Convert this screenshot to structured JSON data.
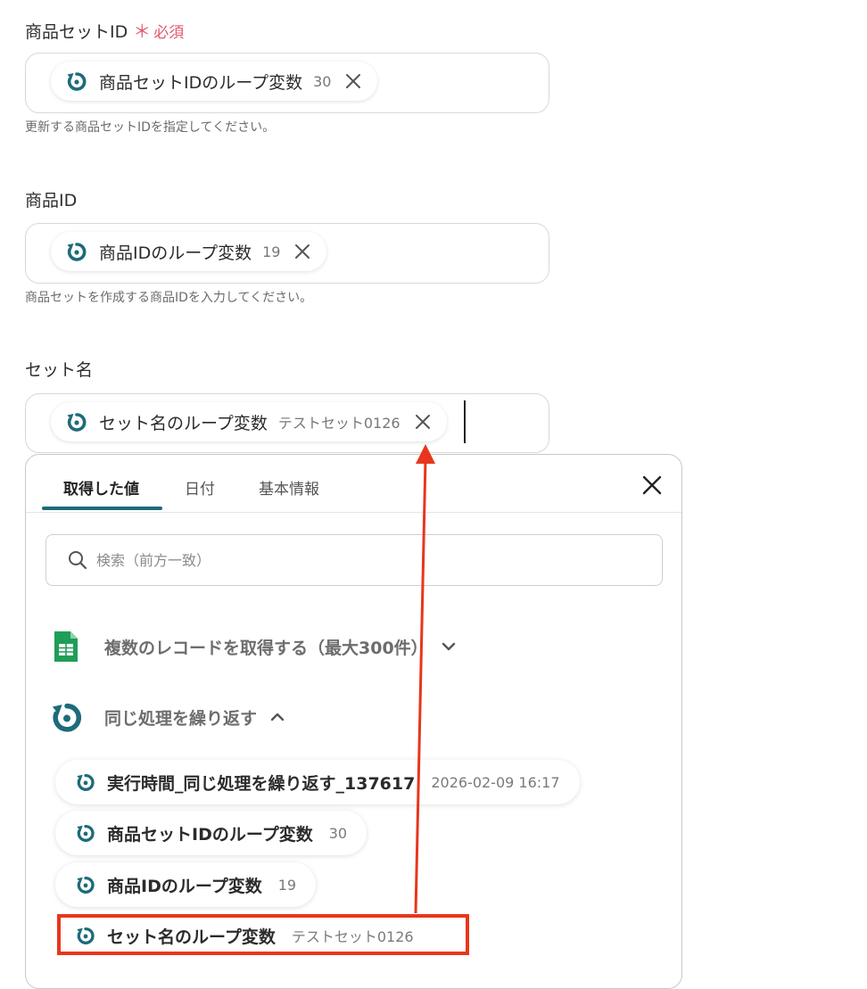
{
  "fields": {
    "set_id": {
      "label": "商品セットID",
      "required_mark": "＊",
      "required_text": "必須",
      "chip_name": "商品セットIDのループ変数",
      "chip_value": "30",
      "help": "更新する商品セットIDを指定してください。"
    },
    "product_id": {
      "label": "商品ID",
      "chip_name": "商品IDのループ変数",
      "chip_value": "19",
      "help": "商品セットを作成する商品IDを入力してください。"
    },
    "set_name": {
      "label": "セット名",
      "chip_name": "セット名のループ変数",
      "chip_value": "テストセット0126"
    }
  },
  "panel": {
    "tabs": [
      {
        "label": "取得した値",
        "active": true
      },
      {
        "label": "日付",
        "active": false
      },
      {
        "label": "基本情報",
        "active": false
      }
    ],
    "search_placeholder": "検索（前方一致）",
    "groups": [
      {
        "label": "複数のレコードを取得する（最大300件）",
        "icon": "spreadsheet-icon",
        "expanded": false
      },
      {
        "label": "同じ処理を繰り返す",
        "icon": "loop-icon",
        "expanded": true
      }
    ],
    "items": [
      {
        "name": "実行時間_同じ処理を繰り返す_137617",
        "value": "2026-02-09 16:17"
      },
      {
        "name": "商品セットIDのループ変数",
        "value": "30"
      },
      {
        "name": "商品IDのループ変数",
        "value": "19"
      },
      {
        "name": "セット名のループ変数",
        "value": "テストセット0126"
      }
    ]
  },
  "colors": {
    "accent": "#1e6b7a",
    "required": "#e05a6d",
    "annotation": "#e8361c",
    "sheets_green": "#1e9e57"
  }
}
